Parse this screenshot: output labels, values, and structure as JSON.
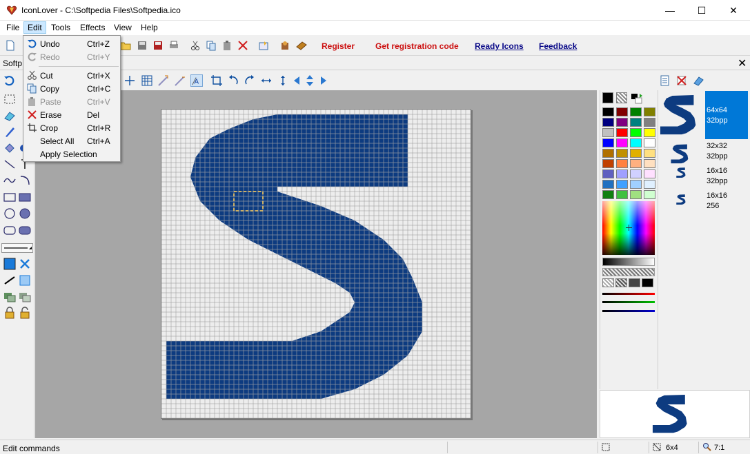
{
  "window": {
    "title": "IconLover - C:\\Softpedia Files\\Softpedia.ico",
    "controls": {
      "minimize": "—",
      "maximize": "☐",
      "close": "✕"
    }
  },
  "menubar": {
    "items": [
      "File",
      "Edit",
      "Tools",
      "Effects",
      "View",
      "Help"
    ]
  },
  "toolbar": {
    "links": {
      "register": "Register",
      "get_code": "Get registration code",
      "ready_icons": "Ready Icons",
      "feedback": "Feedback"
    }
  },
  "document_tab": {
    "label": "Softp",
    "close": "✕"
  },
  "edit_menu": {
    "items": [
      {
        "label": "Undo",
        "shortcut": "Ctrl+Z",
        "enabled": true,
        "icon": "undo-icon"
      },
      {
        "label": "Redo",
        "shortcut": "Ctrl+Y",
        "enabled": false,
        "icon": "redo-icon"
      },
      {
        "label": "Cut",
        "shortcut": "Ctrl+X",
        "enabled": true,
        "icon": "scissors-icon"
      },
      {
        "label": "Copy",
        "shortcut": "Ctrl+C",
        "enabled": true,
        "icon": "copy-icon"
      },
      {
        "label": "Paste",
        "shortcut": "Ctrl+V",
        "enabled": false,
        "icon": "paste-icon"
      },
      {
        "label": "Erase",
        "shortcut": "Del",
        "enabled": true,
        "icon": "erase-x-icon"
      },
      {
        "label": "Crop",
        "shortcut": "Ctrl+R",
        "enabled": true,
        "icon": "crop-icon"
      },
      {
        "label": "Select All",
        "shortcut": "Ctrl+A",
        "enabled": true,
        "icon": ""
      },
      {
        "label": "Apply Selection",
        "shortcut": "",
        "enabled": true,
        "icon": ""
      }
    ]
  },
  "formats": [
    {
      "size": "64x64",
      "depth": "32bpp",
      "selected": true
    },
    {
      "size": "32x32",
      "depth": "32bpp",
      "selected": false
    },
    {
      "size": "16x16",
      "depth": "32bpp",
      "selected": false
    },
    {
      "size": "16x16",
      "depth": "256",
      "selected": false
    }
  ],
  "palette": {
    "rows": [
      [
        "#000000",
        "#800000",
        "#008000",
        "#808000"
      ],
      [
        "#000080",
        "#800080",
        "#008080",
        "#808080"
      ],
      [
        "#c0c0c0",
        "#ff0000",
        "#00ff00",
        "#ffff00"
      ],
      [
        "#0000ff",
        "#ff00ff",
        "#00ffff",
        "#ffffff"
      ],
      [
        "#b07000",
        "#c09000",
        "#e0b000",
        "#ffe080"
      ],
      [
        "#c04000",
        "#ff8040",
        "#ffb080",
        "#ffe0c0"
      ],
      [
        "#6060c0",
        "#a0a0ff",
        "#d0d0ff",
        "#ffe0ff"
      ],
      [
        "#2070c0",
        "#40a0ff",
        "#a0d0ff",
        "#e0f0ff"
      ],
      [
        "#108010",
        "#40c040",
        "#a0e080",
        "#d0ffd0"
      ]
    ],
    "accent_blue": "#0d3b80"
  },
  "status": {
    "text": "Edit commands",
    "selection_size": "6x4",
    "zoom": "7:1"
  }
}
